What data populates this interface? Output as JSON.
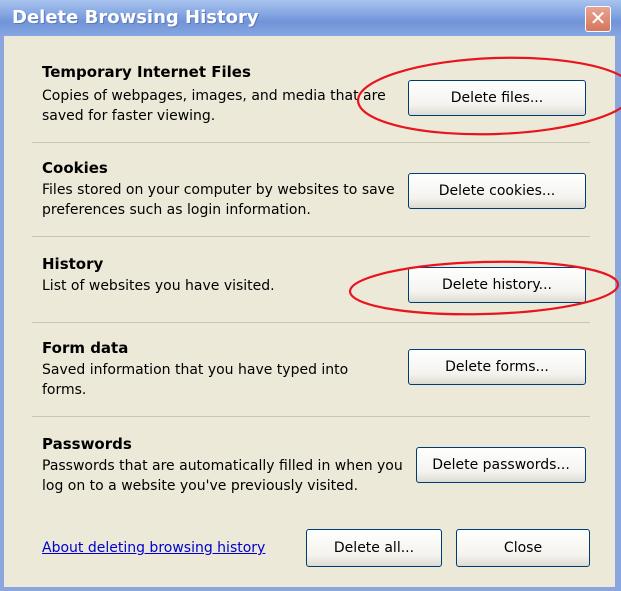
{
  "window": {
    "title": "Delete Browsing History",
    "close_glyph": "✕"
  },
  "sections": [
    {
      "heading": "Temporary Internet Files",
      "description": "Copies of webpages, images, and media that are saved for faster viewing.",
      "button": "Delete files..."
    },
    {
      "heading": "Cookies",
      "description": "Files stored on your computer by websites to save preferences such as login information.",
      "button": "Delete cookies..."
    },
    {
      "heading": "History",
      "description": "List of websites you have visited.",
      "button": "Delete history..."
    },
    {
      "heading": "Form data",
      "description": "Saved information that you have typed into forms.",
      "button": "Delete forms..."
    },
    {
      "heading": "Passwords",
      "description": "Passwords that are automatically filled in when you log on to a website you've previously visited.",
      "button": "Delete passwords..."
    }
  ],
  "footer": {
    "link": "About deleting browsing history",
    "delete_all": "Delete all...",
    "close": "Close"
  },
  "colors": {
    "annotation": "#e8141e",
    "dialog_bg": "#ece9d8",
    "titlebar": "#7ea1e0"
  }
}
